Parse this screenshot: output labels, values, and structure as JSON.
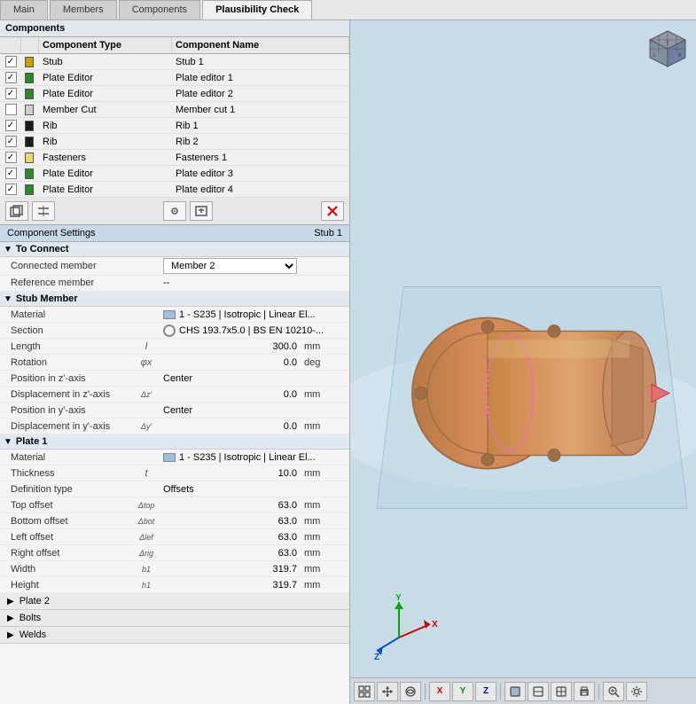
{
  "tabs": [
    {
      "id": "main",
      "label": "Main"
    },
    {
      "id": "members",
      "label": "Members"
    },
    {
      "id": "components",
      "label": "Components"
    },
    {
      "id": "plausibility",
      "label": "Plausibility Check",
      "active": true
    }
  ],
  "left_panel": {
    "section_title": "Components",
    "table": {
      "headers": [
        "",
        "",
        "Component Type",
        "Component Name"
      ],
      "rows": [
        {
          "checked": true,
          "color": "#c8a000",
          "type": "Stub",
          "name": "Stub 1"
        },
        {
          "checked": true,
          "color": "#2a8a2a",
          "type": "Plate Editor",
          "name": "Plate editor 1"
        },
        {
          "checked": true,
          "color": "#2a8a2a",
          "type": "Plate Editor",
          "name": "Plate editor 2"
        },
        {
          "checked": false,
          "color": "#d0d0d0",
          "type": "Member Cut",
          "name": "Member cut 1",
          "selected": false
        },
        {
          "checked": true,
          "color": "#1a1a1a",
          "type": "Rib",
          "name": "Rib 1"
        },
        {
          "checked": true,
          "color": "#1a1a1a",
          "type": "Rib",
          "name": "Rib 2"
        },
        {
          "checked": true,
          "color": "#e8d870",
          "type": "Fasteners",
          "name": "Fasteners 1"
        },
        {
          "checked": true,
          "color": "#2a8a2a",
          "type": "Plate Editor",
          "name": "Plate editor 3"
        },
        {
          "checked": true,
          "color": "#2a8a2a",
          "type": "Plate Editor",
          "name": "Plate editor 4"
        }
      ]
    }
  },
  "toolbar_buttons": [
    {
      "id": "btn1",
      "icon": "⊞",
      "label": "add"
    },
    {
      "id": "btn2",
      "icon": "⊟",
      "label": "remove"
    },
    {
      "id": "btn3",
      "icon": "⚙",
      "label": "settings"
    },
    {
      "id": "btn4",
      "icon": "⇅",
      "label": "sort"
    },
    {
      "id": "btn5",
      "icon": "✕",
      "label": "delete",
      "red": true
    }
  ],
  "props_panel": {
    "title": "Component Settings",
    "subtitle": "Stub 1",
    "groups": [
      {
        "id": "to_connect",
        "label": "To Connect",
        "expanded": true,
        "rows": [
          {
            "label": "Connected member",
            "sym": "",
            "value": "Member 2",
            "unit": "",
            "type": "dropdown"
          },
          {
            "label": "Reference member",
            "sym": "",
            "value": "--",
            "unit": "",
            "type": "text"
          }
        ]
      },
      {
        "id": "stub_member",
        "label": "Stub Member",
        "expanded": true,
        "rows": [
          {
            "label": "Material",
            "sym": "",
            "value": "1 - S235 | Isotropic | Linear El...",
            "unit": "",
            "type": "material"
          },
          {
            "label": "Section",
            "sym": "",
            "value": "CHS 193.7x5.0 | BS EN 10210-...",
            "unit": "",
            "type": "section"
          },
          {
            "label": "Length",
            "sym": "l",
            "value": "300.0",
            "unit": "mm"
          },
          {
            "label": "Rotation",
            "sym": "φx",
            "value": "0.0",
            "unit": "deg"
          },
          {
            "label": "Position in z'-axis",
            "sym": "",
            "value": "Center",
            "unit": "",
            "type": "text-center"
          },
          {
            "label": "Displacement in z'-axis",
            "sym": "Δz'",
            "value": "0.0",
            "unit": "mm"
          },
          {
            "label": "Position in y'-axis",
            "sym": "",
            "value": "Center",
            "unit": "",
            "type": "text-center"
          },
          {
            "label": "Displacement in y'-axis",
            "sym": "Δy'",
            "value": "0.0",
            "unit": "mm"
          }
        ]
      },
      {
        "id": "plate1",
        "label": "Plate 1",
        "expanded": true,
        "rows": [
          {
            "label": "Material",
            "sym": "",
            "value": "1 - S235 | Isotropic | Linear El...",
            "unit": "",
            "type": "material"
          },
          {
            "label": "Thickness",
            "sym": "t",
            "value": "10.0",
            "unit": "mm"
          },
          {
            "label": "Definition type",
            "sym": "",
            "value": "Offsets",
            "unit": "",
            "type": "text-full"
          },
          {
            "label": "Top offset",
            "sym": "Δtop",
            "value": "63.0",
            "unit": "mm"
          },
          {
            "label": "Bottom offset",
            "sym": "Δbot",
            "value": "63.0",
            "unit": "mm"
          },
          {
            "label": "Left offset",
            "sym": "Δlef",
            "value": "63.0",
            "unit": "mm"
          },
          {
            "label": "Right offset",
            "sym": "Δrig",
            "value": "63.0",
            "unit": "mm"
          },
          {
            "label": "Width",
            "sym": "b1",
            "value": "319.7",
            "unit": "mm"
          },
          {
            "label": "Height",
            "sym": "h1",
            "value": "319.7",
            "unit": "mm"
          }
        ]
      }
    ],
    "collapsed_groups": [
      {
        "id": "plate2",
        "label": "Plate 2"
      },
      {
        "id": "bolts",
        "label": "Bolts"
      },
      {
        "id": "welds",
        "label": "Welds"
      }
    ]
  },
  "viewport_toolbar": [
    {
      "icon": "⊞",
      "label": "fit"
    },
    {
      "icon": "⌖",
      "label": "center"
    },
    {
      "icon": "👁",
      "label": "view"
    },
    {
      "sep": true
    },
    {
      "icon": "x",
      "label": "x-axis"
    },
    {
      "icon": "y",
      "label": "y-axis"
    },
    {
      "icon": "z",
      "label": "z-axis"
    },
    {
      "sep": true
    },
    {
      "icon": "◻",
      "label": "render"
    },
    {
      "icon": "⬜",
      "label": "shading"
    },
    {
      "icon": "⊡",
      "label": "wireframe"
    },
    {
      "icon": "🖨",
      "label": "print"
    },
    {
      "sep": true
    },
    {
      "icon": "⊕",
      "label": "zoom"
    },
    {
      "icon": "⊡",
      "label": "options"
    }
  ]
}
